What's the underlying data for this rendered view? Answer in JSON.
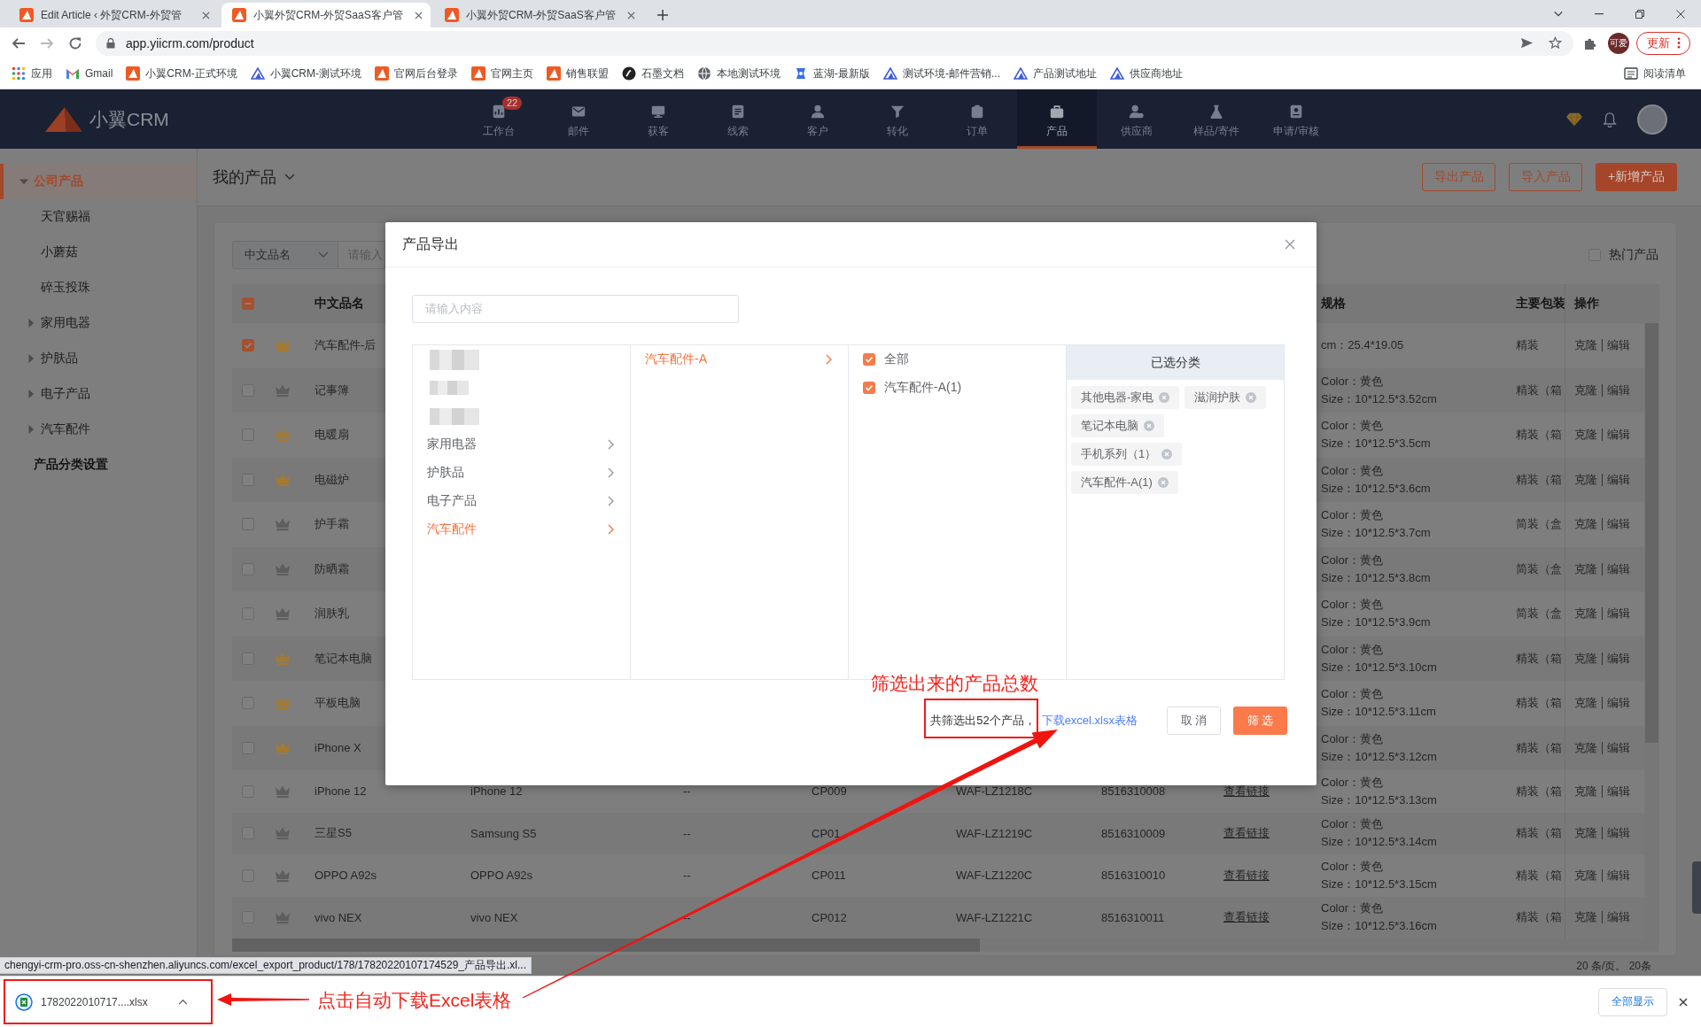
{
  "browser": {
    "tabs": [
      {
        "title": "Edit Article ‹ 外贸CRM-外贸管",
        "selected": false
      },
      {
        "title": "小翼外贸CRM-外贸SaaS客户管",
        "selected": true
      },
      {
        "title": "小翼外贸CRM-外贸SaaS客户管",
        "selected": false
      }
    ],
    "url": "app.yiicrm.com/product",
    "profile": "可爱",
    "update": "更新",
    "bookmarks": [
      {
        "label": "应用",
        "kind": "apps"
      },
      {
        "label": "Gmail",
        "kind": "mail"
      },
      {
        "label": "小翼CRM-正式环境",
        "kind": "site"
      },
      {
        "label": "小翼CRM-测试环境",
        "kind": "outline"
      },
      {
        "label": "官网后台登录",
        "kind": "site"
      },
      {
        "label": "官网主页",
        "kind": "site"
      },
      {
        "label": "销售联盟",
        "kind": "site"
      },
      {
        "label": "石墨文档",
        "kind": "doc"
      },
      {
        "label": "本地测试环境",
        "kind": "globe"
      },
      {
        "label": "蓝湖-最新版",
        "kind": "design"
      },
      {
        "label": "测试环境-邮件营销...",
        "kind": "outline"
      },
      {
        "label": "产品测试地址",
        "kind": "outline"
      },
      {
        "label": "供应商地址",
        "kind": "outline"
      }
    ],
    "reading_list": "阅读清单"
  },
  "header": {
    "logo": "小翼CRM",
    "nav": [
      {
        "label": "工作台",
        "kind": "desk",
        "badge": "22",
        "selected": false
      },
      {
        "label": "邮件",
        "kind": "mail",
        "selected": false
      },
      {
        "label": "获客",
        "kind": "screen",
        "selected": false
      },
      {
        "label": "线索",
        "kind": "list",
        "selected": false
      },
      {
        "label": "客户",
        "kind": "person",
        "selected": false
      },
      {
        "label": "转化",
        "kind": "funnel",
        "selected": false
      },
      {
        "label": "订单",
        "kind": "clipboard",
        "selected": false
      },
      {
        "label": "产品",
        "kind": "bag",
        "selected": true
      },
      {
        "label": "供应商",
        "kind": "team",
        "selected": false
      },
      {
        "label": "样品/寄件",
        "kind": "flask",
        "selected": false
      },
      {
        "label": "申请/审核",
        "kind": "form",
        "selected": false
      }
    ]
  },
  "sidebar": {
    "tree": [
      {
        "label": "公司产品",
        "kind": "branch",
        "expanded": true,
        "selected": true,
        "children": [
          {
            "label": "天官赐福",
            "kind": "leaf",
            "selected": false
          },
          {
            "label": "小蘑菇",
            "kind": "leaf",
            "selected": false
          },
          {
            "label": "碎玉投珠",
            "kind": "leaf",
            "selected": false
          },
          {
            "label": "家用电器",
            "kind": "branch",
            "expanded": false,
            "selected": false
          },
          {
            "label": "护肤品",
            "kind": "branch",
            "expanded": false,
            "selected": false
          },
          {
            "label": "电子产品",
            "kind": "branch",
            "expanded": false,
            "selected": false
          },
          {
            "label": "汽车配件",
            "kind": "branch",
            "expanded": false,
            "selected": false
          }
        ]
      }
    ],
    "settings_link": "产品分类设置"
  },
  "products": {
    "title": "我的产品",
    "buttons": [
      {
        "label": "导出产品",
        "kind": "outline"
      },
      {
        "label": "导入产品",
        "kind": "outline"
      },
      {
        "label": "+新增产品",
        "kind": "filled"
      }
    ],
    "filter": {
      "field": "中文品名",
      "placeholder": "请输入"
    },
    "hot_filter": {
      "label": "热门产品",
      "checked": false
    },
    "table": {
      "header_checkbox": {
        "checked": false,
        "indeterminate": true
      },
      "columns": {
        "name": "中文品名",
        "spec": "规格",
        "package": "主要包装",
        "actions": "操作"
      },
      "rows": [
        {
          "selected": true,
          "hot": true,
          "name": "汽车配件-后",
          "spec": [
            "cm：25.4*19.05"
          ],
          "package": "精装",
          "actions": [
            "克隆",
            "编辑"
          ]
        },
        {
          "selected": false,
          "hot": false,
          "name": "记事簿",
          "spec": [
            "Color：黄色",
            "Size：10*12.5*3.52cm"
          ],
          "package": "精装（箱",
          "actions": [
            "克隆",
            "编辑"
          ]
        },
        {
          "selected": false,
          "hot": true,
          "name": "电暖扇",
          "spec": [
            "Color：黄色",
            "Size：10*12.5*3.5cm"
          ],
          "package": "精装（箱",
          "actions": [
            "克隆",
            "编辑"
          ]
        },
        {
          "selected": false,
          "hot": true,
          "name": "电磁炉",
          "spec": [
            "Color：黄色",
            "Size：10*12.5*3.6cm"
          ],
          "package": "精装（箱",
          "actions": [
            "克隆",
            "编辑"
          ]
        },
        {
          "selected": false,
          "hot": false,
          "name": "护手霜",
          "spec": [
            "Color：黄色",
            "Size：10*12.5*3.7cm"
          ],
          "package": "简装（盒",
          "actions": [
            "克隆",
            "编辑"
          ]
        },
        {
          "selected": false,
          "hot": false,
          "name": "防晒霜",
          "spec": [
            "Color：黄色",
            "Size：10*12.5*3.8cm"
          ],
          "package": "简装（盒",
          "actions": [
            "克隆",
            "编辑"
          ]
        },
        {
          "selected": false,
          "hot": false,
          "name": "润肤乳",
          "spec": [
            "Color：黄色",
            "Size：10*12.5*3.9cm"
          ],
          "package": "简装（盒",
          "actions": [
            "克隆",
            "编辑"
          ]
        },
        {
          "selected": false,
          "hot": true,
          "name": "笔记本电脑",
          "spec": [
            "Color：黄色",
            "Size：10*12.5*3.10cm"
          ],
          "package": "精装（箱",
          "actions": [
            "克隆",
            "编辑"
          ]
        },
        {
          "selected": false,
          "hot": true,
          "name": "平板电脑",
          "spec": [
            "Color：黄色",
            "Size：10*12.5*3.11cm"
          ],
          "package": "精装（箱",
          "actions": [
            "克隆",
            "编辑"
          ]
        },
        {
          "selected": false,
          "hot": true,
          "name": "iPhone X",
          "spec": [
            "Color：黄色",
            "Size：10*12.5*3.12cm"
          ],
          "package": "精装（箱",
          "actions": [
            "克隆",
            "编辑"
          ]
        },
        {
          "selected": false,
          "hot": false,
          "name": "iPhone 12",
          "column_4": "iPhone 12",
          "column_5": "--",
          "column_6": "CP009",
          "column_7": "WAF-LZ1218C",
          "column_8": "8516310008",
          "column_9": "查看链接",
          "spec": [
            "Color：黄色",
            "Size：10*12.5*3.13cm"
          ],
          "package": "精装（箱",
          "actions": [
            "克隆",
            "编辑"
          ]
        },
        {
          "selected": false,
          "hot": false,
          "name": "三星S5",
          "column_4": "Samsung S5",
          "column_5": "--",
          "column_6": "CP01",
          "column_7": "WAF-LZ1219C",
          "column_8": "8516310009",
          "column_9": "查看链接",
          "spec": [
            "Color：黄色",
            "Size：10*12.5*3.14cm"
          ],
          "package": "精装（箱",
          "actions": [
            "克隆",
            "编辑"
          ]
        },
        {
          "selected": false,
          "hot": false,
          "name": "OPPO A92s",
          "column_4": "OPPO A92s",
          "column_5": "--",
          "column_6": "CP011",
          "column_7": "WAF-LZ1220C",
          "column_8": "8516310010",
          "column_9": "查看链接",
          "spec": [
            "Color：黄色",
            "Size：10*12.5*3.15cm"
          ],
          "package": "精装（箱",
          "actions": [
            "克隆",
            "编辑"
          ]
        },
        {
          "selected": false,
          "hot": false,
          "name": "vivo NEX",
          "column_4": "vivo NEX",
          "column_5": "--",
          "column_6": "CP012",
          "column_7": "WAF-LZ1221C",
          "column_8": "8516310011",
          "column_9": "查看链接",
          "spec": [
            "Color：黄色",
            "Size：10*12.5*3.16cm"
          ],
          "package": "精装（箱",
          "actions": [
            "克隆",
            "编辑"
          ]
        }
      ]
    },
    "pagination": "20 条/页。 20条"
  },
  "dialog": {
    "title": "产品导出",
    "search_placeholder": "请输入内容",
    "cascader": [
      {
        "kind": "menu",
        "options": [
          {
            "kind": "blurred",
            "selected": false
          },
          {
            "kind": "blurred",
            "selected": false
          },
          {
            "kind": "blurred",
            "selected": false
          },
          {
            "kind": "label",
            "label": "家用电器",
            "selected": false
          },
          {
            "kind": "label",
            "label": "护肤品",
            "selected": false
          },
          {
            "kind": "label",
            "label": "电子产品",
            "selected": false
          },
          {
            "kind": "label",
            "label": "汽车配件",
            "selected": true
          }
        ]
      },
      {
        "kind": "menu",
        "options": [
          {
            "kind": "label",
            "label": "汽车配件-A",
            "selected": true
          }
        ]
      },
      {
        "kind": "checklist",
        "options": [
          {
            "label": "全部",
            "checked": true
          },
          {
            "label": "汽车配件-A(1)",
            "checked": true
          }
        ]
      }
    ],
    "selected_panel": {
      "title": "已选分类",
      "tags": [
        "其他电器-家电",
        "滋润护肤",
        "笔记本电脑",
        "手机系列（1）",
        "汽车配件-A(1)"
      ]
    },
    "summary": "共筛选出52个产品，",
    "download_link": "下载excel.xlsx表格",
    "buttons": [
      {
        "label": "取 消",
        "kind": "plain"
      },
      {
        "label": "筛 选",
        "kind": "primary"
      }
    ]
  },
  "annotations": [
    {
      "kind": "count_note",
      "text": "筛选出来的产品总数"
    },
    {
      "kind": "download_note",
      "text": "点击自动下载Excel表格"
    }
  ],
  "status_url": "chengyi-crm-pro.oss-cn-shenzhen.aliyuncs.com/excel_export_product/178/17820220107174529_产品导出.xl...",
  "download_bar": {
    "file": "1782022010717....xlsx",
    "show_all": "全部显示"
  }
}
